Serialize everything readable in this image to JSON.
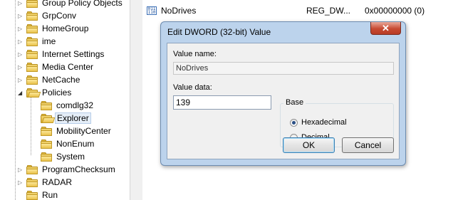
{
  "tree": {
    "items": [
      {
        "label": "Group Policy Objects"
      },
      {
        "label": "GrpConv"
      },
      {
        "label": "HomeGroup"
      },
      {
        "label": "ime"
      },
      {
        "label": "Internet Settings"
      },
      {
        "label": "Media Center"
      },
      {
        "label": "NetCache"
      },
      {
        "label": "Policies"
      },
      {
        "label": "comdlg32"
      },
      {
        "label": "Explorer"
      },
      {
        "label": "MobilityCenter"
      },
      {
        "label": "NonEnum"
      },
      {
        "label": "System"
      },
      {
        "label": "ProgramChecksum"
      },
      {
        "label": "RADAR"
      },
      {
        "label": "Run"
      }
    ]
  },
  "values_list": {
    "row": {
      "name": "NoDrives",
      "type": "REG_DW...",
      "data": "0x00000000 (0)",
      "icon": "reg-binary-icon"
    }
  },
  "dialog": {
    "title": "Edit DWORD (32-bit) Value",
    "close_glyph": "✕",
    "value_name_label": "Value name:",
    "value_name": "NoDrives",
    "value_data_label": "Value data:",
    "value_data": "139",
    "base_label": "Base",
    "base_options": [
      "Hexadecimal",
      "Decimal"
    ],
    "base_selected": "Hexadecimal",
    "ok_label": "OK",
    "cancel_label": "Cancel"
  }
}
